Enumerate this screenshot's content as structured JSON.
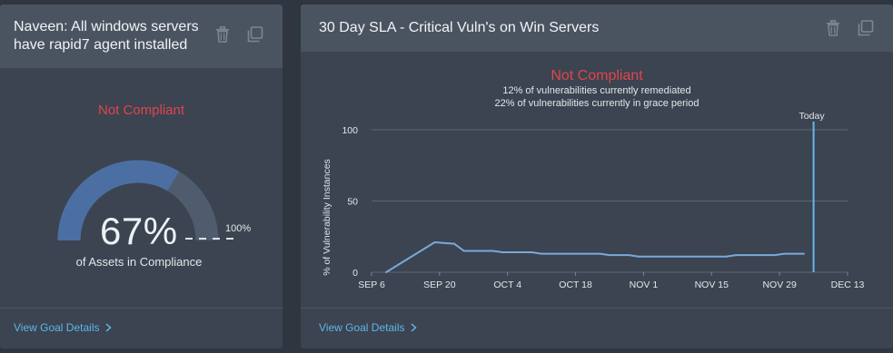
{
  "colors": {
    "page_bg": "#2f3640",
    "card_bg": "#3b4450",
    "header_bg": "#4a5461",
    "accent_blue": "#5fb6e9",
    "status_red": "#e0454d",
    "gauge_fill": "#4b6fa3",
    "gauge_track": "#4f5c6e",
    "line_series": "#7aa9d9",
    "today_line": "#69b6ea"
  },
  "card1": {
    "title": "Naveen: All windows servers have rapid7 agent installed",
    "delete_icon": "trash-icon",
    "duplicate_icon": "copy-icon",
    "status": "Not Compliant",
    "gauge": {
      "value_fraction": 0.67,
      "percent_label": "67%",
      "target_label": "100%",
      "caption": "of Assets in Compliance"
    },
    "footer_link": "View Goal Details"
  },
  "card2": {
    "title": "30 Day SLA - Critical Vuln's on Win Servers",
    "delete_icon": "trash-icon",
    "duplicate_icon": "copy-icon",
    "status": "Not Compliant",
    "subtitle_line1": "12% of vulnerabilities currently remediated",
    "subtitle_line2": "22% of vulnerabilities currently in grace period",
    "footer_link": "View Goal Details"
  },
  "chart_data": {
    "type": "line",
    "ylabel": "% of Vulnerability Instances",
    "xlabel": "",
    "ylim": [
      0,
      100
    ],
    "yticks": [
      0,
      50,
      100
    ],
    "xlim": [
      "2021-09-06",
      "2021-12-13"
    ],
    "xtick_labels": [
      "SEP 6",
      "SEP 20",
      "OCT 4",
      "OCT 18",
      "NOV 1",
      "NOV 15",
      "NOV 29",
      "DEC 13"
    ],
    "xtick_dates": [
      "2021-09-06",
      "2021-09-20",
      "2021-10-04",
      "2021-10-18",
      "2021-11-01",
      "2021-11-15",
      "2021-11-29",
      "2021-12-13"
    ],
    "grid": true,
    "today_marker": {
      "label": "Today",
      "date": "2021-12-06"
    },
    "series": [
      {
        "x": [
          "2021-09-09",
          "2021-09-19",
          "2021-09-23",
          "2021-09-25",
          "2021-10-01",
          "2021-10-03",
          "2021-10-09",
          "2021-10-11",
          "2021-10-23",
          "2021-10-25",
          "2021-10-29",
          "2021-10-31",
          "2021-11-18",
          "2021-11-20",
          "2021-11-28",
          "2021-11-30",
          "2021-12-04"
        ],
        "y": [
          0,
          21,
          20,
          15,
          15,
          14,
          14,
          13,
          13,
          12,
          12,
          11,
          11,
          12,
          12,
          13,
          13
        ]
      }
    ]
  }
}
